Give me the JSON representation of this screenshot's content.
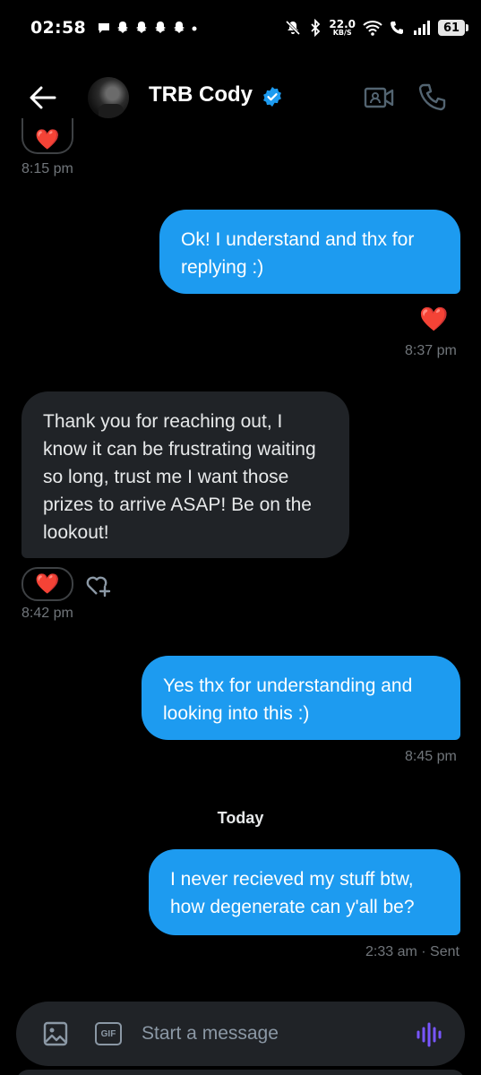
{
  "status_bar": {
    "time": "02:58",
    "net_speed_value": "22.0",
    "net_speed_unit": "KB/S",
    "battery": "61"
  },
  "header": {
    "contact_name": "TRB Cody",
    "verified": true,
    "icons": [
      "back-arrow-icon",
      "verified-badge-icon",
      "video-call-icon",
      "phone-icon"
    ]
  },
  "conversation": {
    "messages": [
      {
        "direction": "in",
        "time": "8:15 pm",
        "reaction": "❤️"
      },
      {
        "direction": "out",
        "text": "Ok! I understand and thx for replying :)",
        "reaction": "❤️",
        "time": "8:37 pm"
      },
      {
        "direction": "in",
        "text": "Thank you for reaching out, I know it can be frustrating waiting so long, trust me I want those prizes to arrive ASAP! Be on the lookout!",
        "reaction": "❤️",
        "time": "8:42 pm"
      },
      {
        "direction": "out",
        "text": "Yes thx for understanding and looking into this :)",
        "time": "8:45 pm"
      },
      {
        "direction": "out",
        "text": "I never recieved my stuff btw, how degenerate can y'all be?",
        "time": "2:33 am · Sent"
      }
    ],
    "day_divider": "Today"
  },
  "composer": {
    "placeholder": "Start a message",
    "gif_label": "GIF",
    "accent": "#7856ff"
  },
  "colors": {
    "outgoing_bubble": "#1d9bf0",
    "incoming_bubble": "#202327",
    "timestamp": "#71767b",
    "background": "#000000"
  }
}
